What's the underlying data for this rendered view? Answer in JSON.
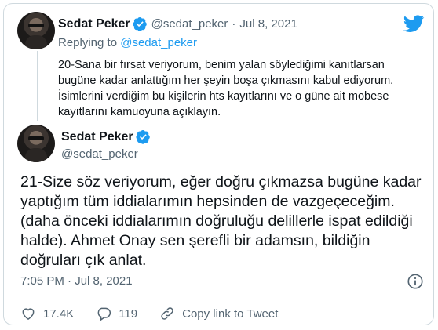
{
  "reply_tweet": {
    "display_name": "Sedat Peker",
    "handle": "@sedat_peker",
    "separator": "·",
    "date": "Jul 8, 2021",
    "replying_prefix": "Replying to",
    "replying_to": "@sedat_peker",
    "text_lines": [
      "20-Sana bir fırsat veriyorum, benim yalan söylediğimi kanıtlarsan",
      "bugüne kadar anlattığım her şeyin boşa çıkmasını kabul ediyorum.",
      "İsimlerini verdiğim bu kişilerin hts kayıtlarını ve o güne ait mobese",
      "kayıtlarını kamuoyuna açıklayın."
    ]
  },
  "main_tweet": {
    "display_name": "Sedat Peker",
    "handle": "@sedat_peker",
    "text_lines": [
      "21-Size söz veriyorum, eğer doğru çıkmazsa bugüne kadar",
      "yaptığım tüm iddialarımın hepsinden de vazgeçeceğim.",
      "(daha önceki iddialarımın doğruluğu delillerle ispat edildiği",
      "halde). Ahmet Onay sen şerefli bir adamsın, bildiğin",
      "doğruları çık anlat."
    ],
    "timestamp": "7:05 PM · Jul 8, 2021"
  },
  "actions": {
    "likes": "17.4K",
    "replies": "119",
    "copy_link": "Copy link to Tweet"
  },
  "colors": {
    "accent": "#1d9bf0",
    "secondary_text": "#536471",
    "border": "#cfd9de"
  },
  "icons": [
    "twitter-logo-icon",
    "verified-badge-icon",
    "info-icon",
    "heart-icon",
    "reply-icon",
    "link-icon"
  ]
}
